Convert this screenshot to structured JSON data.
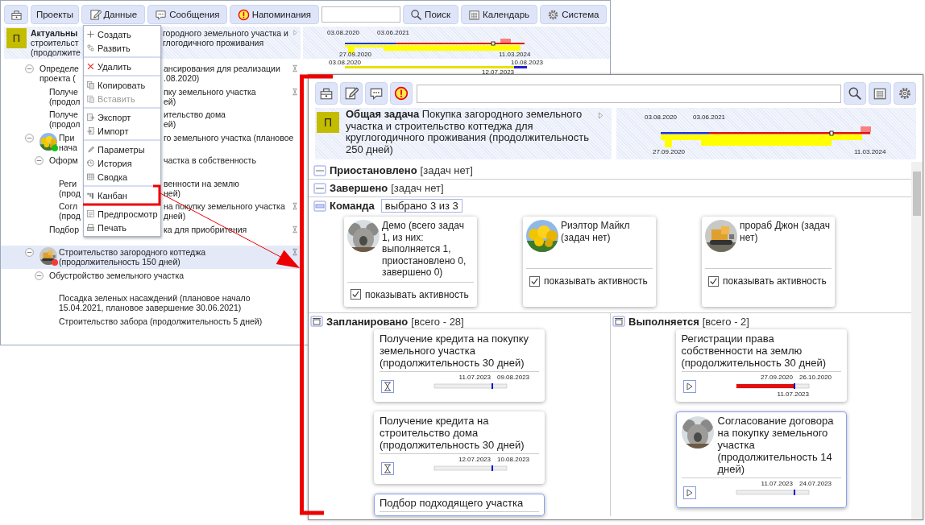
{
  "project_window": {
    "toolbar": [
      {
        "kind": "briefcase"
      },
      {
        "kind": "text",
        "label": "Проекты"
      },
      {
        "kind": "edit",
        "label": "Данные"
      },
      {
        "kind": "chat",
        "label": "Сообщения"
      },
      {
        "kind": "alert",
        "label": "Напоминания"
      },
      {
        "kind": "field"
      },
      {
        "kind": "search",
        "label": "Поиск"
      },
      {
        "kind": "calendar",
        "label": "Календарь"
      },
      {
        "kind": "gear",
        "label": "Система"
      }
    ],
    "header": {
      "badge": "П",
      "lines": [
        [
          "**Актуальны**",
          "городного земельного участка и"
        ],
        [
          "строительст",
          "глогодичного проживания"
        ],
        [
          "(продолжите"
        ]
      ]
    },
    "timeline": {
      "dates": [
        "03.08.2020",
        "03.06.2021",
        "27.09.2020",
        "11.03.2024"
      ]
    },
    "first_row_timeline": {
      "dates": [
        "03.08.2020",
        "10.08.2023",
        "12.07.2023"
      ]
    },
    "tree": [
      {
        "lines": [
          [
            "Определе",
            "ансирования для реализации"
          ],
          [
            "проекта (",
            ".08.2020)"
          ]
        ],
        "waiting": true,
        "selected": false,
        "expanded": true,
        "children": [
          {
            "lines": [
              [
                "Получе",
                "пку земельного участка"
              ],
              [
                "(продол",
                "ей)"
              ]
            ],
            "waiting": true,
            "selected": false
          },
          {
            "lines": [
              [
                "Получе",
                "ительство дома"
              ],
              [
                "(продол",
                "ей)"
              ]
            ],
            "waiting": false,
            "selected": false
          }
        ]
      },
      {
        "lines": [
          [
            "При",
            "го земельного участка (плановое"
          ],
          [
            "нача"
          ]
        ],
        "avatar": {
          "kind": "picture",
          "color": "#19c019"
        },
        "waiting": false,
        "selected": false,
        "expanded": true,
        "children": [
          {
            "lines": [
              [
                "Оформ",
                "частка в собственность"
              ]
            ],
            "waiting": false,
            "selected": false,
            "expanded": true,
            "children": [
              {
                "lines": [
                  [
                    "Реги",
                    "венности на землю"
                  ],
                  [
                    "(прод",
                    "ней)"
                  ]
                ],
                "waiting": false,
                "selected": false
              },
              {
                "lines": [
                  [
                    "Согл",
                    "на покупку земельного участка"
                  ],
                  [
                    "(прод",
                    "дней)"
                  ]
                ],
                "waiting": true,
                "selected": false
              }
            ]
          },
          {
            "lines": [
              [
                "Подбор",
                "ка для приобритения"
              ]
            ],
            "waiting": true,
            "selected": false
          }
        ]
      },
      {
        "lines": [
          [
            "Строительство загородного коттеджа"
          ],
          [
            "(продолжительность 150 дней)"
          ]
        ],
        "avatar": {
          "kind": "picture",
          "color": "#f03c3c"
        },
        "waiting": true,
        "selected": true,
        "expanded": true,
        "children": [
          {
            "lines": [
              [
                "Обустройство земельного участка"
              ]
            ],
            "waiting": false,
            "selected": false,
            "expanded": true,
            "children": [
              {
                "lines": [
                  [
                    "Посадка зеленых насаждений (плановое начало"
                  ],
                  [
                    "15.04.2021, плановое завершение 30.06.2021)"
                  ]
                ],
                "waiting": false,
                "selected": false
              },
              {
                "lines": [
                  [
                    "Строительство забора (продолжительность 5 дней)"
                  ]
                ],
                "waiting": false,
                "selected": false
              }
            ]
          }
        ]
      }
    ]
  },
  "data_menu": [
    [
      {
        "kind": "create",
        "label": "Создать",
        "disabled": false
      },
      {
        "kind": "develop",
        "label": "Развить",
        "disabled": false
      }
    ],
    [
      {
        "kind": "delete",
        "label": "Удалить",
        "disabled": false
      }
    ],
    [
      {
        "kind": "copy",
        "label": "Копировать",
        "disabled": false
      },
      {
        "kind": "paste",
        "label": "Вставить",
        "disabled": true
      }
    ],
    [
      {
        "kind": "export",
        "label": "Экспорт",
        "disabled": false
      },
      {
        "kind": "import",
        "label": "Импорт",
        "disabled": false
      }
    ],
    [
      {
        "kind": "params",
        "label": "Параметры",
        "disabled": false
      },
      {
        "kind": "history",
        "label": "История",
        "disabled": false
      },
      {
        "kind": "summary",
        "label": "Сводка",
        "disabled": false
      }
    ],
    [
      {
        "kind": "kanban",
        "label": "Канбан",
        "disabled": false
      }
    ],
    [
      {
        "kind": "preview",
        "label": "Предпросмотр",
        "disabled": false
      },
      {
        "kind": "print",
        "label": "Печать",
        "disabled": false
      }
    ]
  ],
  "kanban_window": {
    "toolbar": [
      {
        "kind": "briefcase"
      },
      {
        "kind": "edit"
      },
      {
        "kind": "chat"
      },
      {
        "kind": "alert"
      },
      {
        "kind": "field"
      },
      {
        "kind": "search"
      },
      {
        "kind": "calendar"
      },
      {
        "kind": "gear"
      }
    ],
    "header": {
      "badge": "П",
      "text": "**Общая задача** Покупка загородного земельного участка и строительство коттеджа для круглогодичного проживания (продолжительность 250 дней)"
    },
    "timeline": {
      "dates": [
        "03.08.2020",
        "03.06.2021",
        "27.09.2020",
        "11.03.2024"
      ]
    },
    "sections": [
      {
        "title": "Приостановлено",
        "note": "[задач нет]",
        "collapsed": true
      },
      {
        "title": "Завершено",
        "note": "[задач нет]",
        "collapsed": true
      }
    ],
    "team": {
      "title": "Команда",
      "filter": "выбрано 3 из 3",
      "collapsed": false,
      "members": [
        {
          "name": "Демо (всего задач 1, из них: выполняется 1, приостановлено 0, завершено 0)",
          "avatar": {
            "kind": "picture"
          },
          "option": "показывать активность",
          "checked": true
        },
        {
          "name": "Риэлтор Майкл (задач нет)",
          "avatar": {
            "kind": "picture"
          },
          "option": "показывать активность",
          "checked": true
        },
        {
          "name": "прораб Джон (задач нет)",
          "avatar": {
            "kind": "picture"
          },
          "option": "показывать активность",
          "checked": true
        }
      ]
    },
    "columns": [
      {
        "kind": "planned",
        "title": "Запланировано",
        "count": "[всего - 28]",
        "cards": [
          {
            "text": "Получение кредита на покупку земельного участка (продолжительность 30 дней)",
            "dates": [
              "11.07.2023",
              "09.08.2023"
            ],
            "selected": false
          },
          {
            "text": "Получение кредита на строительство дома (продолжительность 30 дней)",
            "dates": [
              "12.07.2023",
              "10.08.2023"
            ],
            "selected": false
          },
          {
            "text": "Подбор подходящего участка",
            "selected": true
          }
        ]
      },
      {
        "kind": "running",
        "title": "Выполняется",
        "count": "[всего - 2]",
        "cards": [
          {
            "text": "Регистрации права собственности на землю (продолжительность 30 дней)",
            "dates": [
              "27.09.2020",
              "26.10.2020",
              "11.07.2023"
            ],
            "level": 0.8,
            "selected": false
          },
          {
            "text": "Согласование договора на покупку земельного участка (продолжительность 14 дней)",
            "avatar": {
              "kind": "picture"
            },
            "dates": [
              "11.07.2023",
              "24.07.2023"
            ],
            "selected": true
          }
        ]
      }
    ]
  }
}
